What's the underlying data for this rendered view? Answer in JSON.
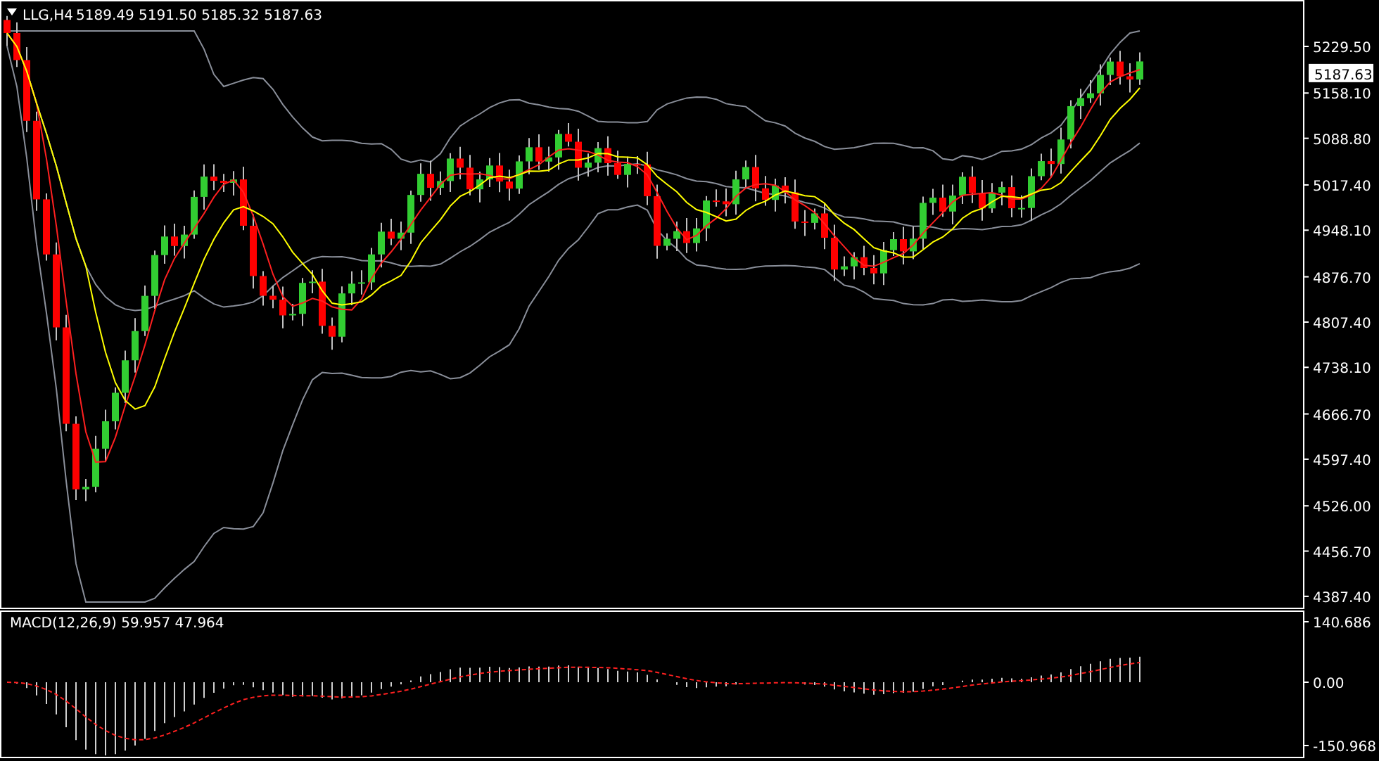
{
  "chart": {
    "symbol": "LLG,H4",
    "ohlc": [
      "5189.49",
      "5191.50",
      "5185.32",
      "5187.63"
    ]
  },
  "price_axis": {
    "ticks": [
      "5229.50",
      "5158.10",
      "5088.80",
      "5017.40",
      "4948.10",
      "4876.70",
      "4807.40",
      "4738.10",
      "4666.70",
      "4597.40",
      "4526.00",
      "4456.70",
      "4387.40"
    ],
    "current_price": "5187.63"
  },
  "macd": {
    "label": "MACD(12,26,9) 59.957 47.964",
    "ticks": [
      "140.686",
      "0.00",
      "-150.968"
    ]
  }
}
